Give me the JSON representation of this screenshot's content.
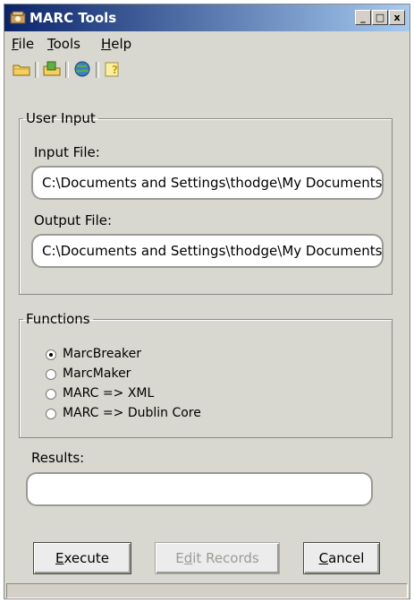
{
  "window": {
    "title": "MARC Tools",
    "controls": {
      "minimize": "_",
      "maximize": "□",
      "close": "x"
    }
  },
  "menu": {
    "file": {
      "first": "F",
      "rest": "ile"
    },
    "tools": {
      "first": "T",
      "rest": "ools"
    },
    "help": {
      "first": "H",
      "rest": "elp"
    }
  },
  "toolbar": [
    "open-folder-icon",
    "open-record-icon",
    "globe-icon",
    "help-icon"
  ],
  "user_input": {
    "legend": "User Input",
    "input_label": "Input File:",
    "input_value": "C:\\Documents and Settings\\thodge\\My Documents",
    "output_label": "Output File:",
    "output_value": "C:\\Documents and Settings\\thodge\\My Documents"
  },
  "functions": {
    "legend": "Functions",
    "options": [
      "MarcBreaker",
      "MarcMaker",
      "MARC => XML",
      "MARC => Dublin Core"
    ],
    "selected": "MarcBreaker"
  },
  "results": {
    "label": "Results:",
    "value": ""
  },
  "buttons": {
    "execute": {
      "first": "E",
      "rest": "xecute"
    },
    "edit_records": {
      "before": "E",
      "underlined": "d",
      "after": "it Records"
    },
    "cancel": {
      "first": "C",
      "rest": "ancel"
    }
  },
  "colors": {
    "title_start": "#0a246a",
    "title_end": "#a6caf0",
    "window_bg": "#d8d8d0"
  }
}
